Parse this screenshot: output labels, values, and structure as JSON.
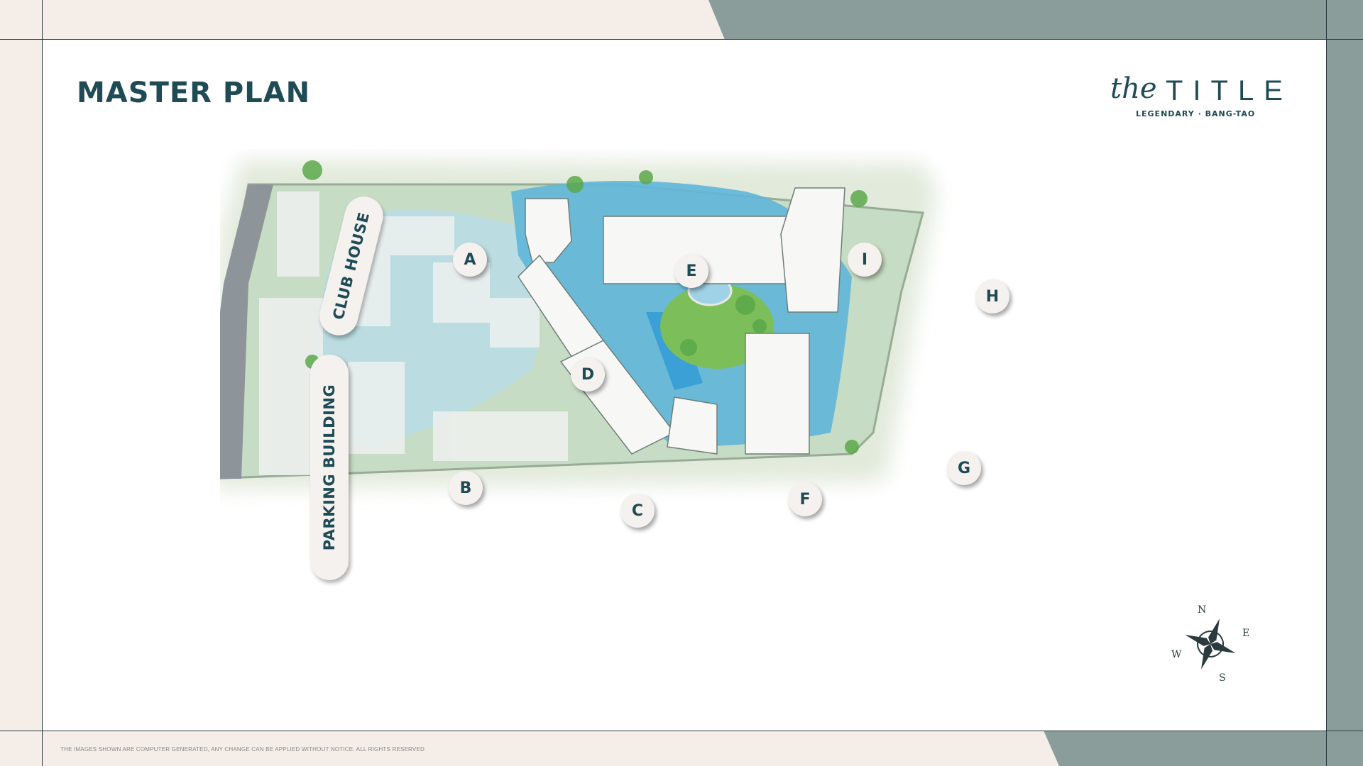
{
  "header": {
    "title": "MASTER PLAN"
  },
  "brand": {
    "word_the": "the",
    "word_title": "TITLE",
    "tagline": "LEGENDARY · BANG-TAO"
  },
  "map": {
    "buildings": [
      "A",
      "B",
      "C",
      "D",
      "E",
      "F",
      "G",
      "H",
      "I"
    ],
    "facilities": {
      "club_house": "CLUB HOUSE",
      "parking_building": "PARKING BUILDING"
    }
  },
  "compass": {
    "n": "N",
    "e": "E",
    "s": "S",
    "w": "W"
  },
  "footer": {
    "disclaimer": "THE IMAGES SHOWN ARE COMPUTER GENERATED, ANY CHANGE CAN BE APPLIED WITHOUT NOTICE. ALL RIGHTS RESERVED"
  },
  "colors": {
    "brand": "#1e4b55",
    "accent_green": "#8bc34a",
    "frame_teal": "#8a9d9b",
    "frame_beige": "#f4ede8"
  }
}
